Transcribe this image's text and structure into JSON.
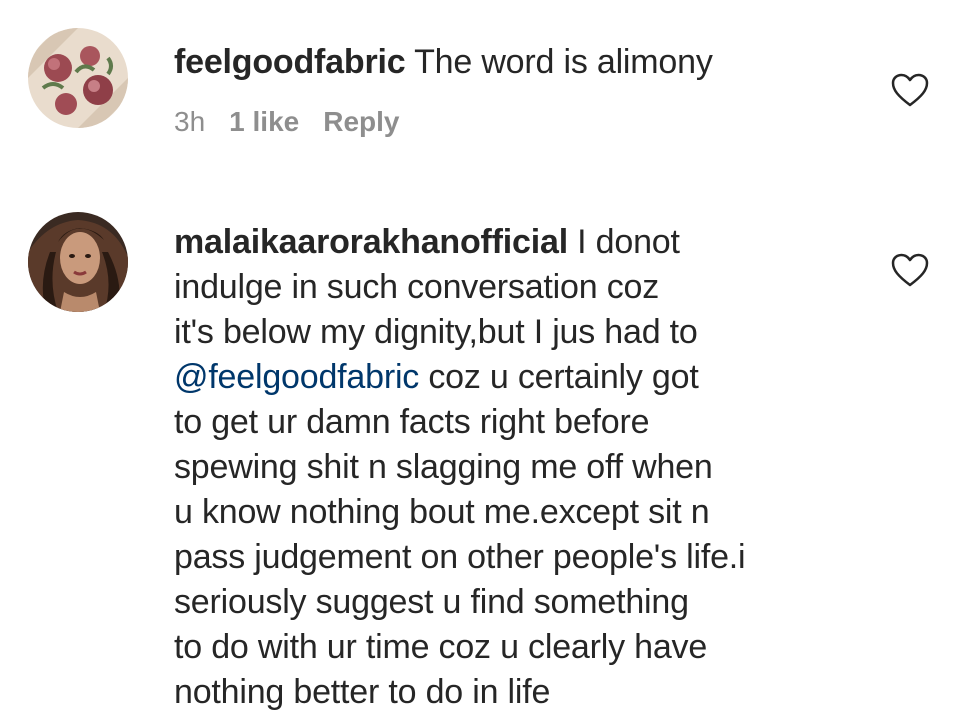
{
  "comments": [
    {
      "username": "feelgoodfabric",
      "text": " The word is alimony",
      "time": "3h",
      "likes": "1 like",
      "reply": "Reply",
      "avatar_icon": "floral-fabric-avatar",
      "like_icon": "heart-outline-icon"
    },
    {
      "username": "malaikaarorakhanofficial",
      "lines": [
        " I donot",
        "indulge in such conversation coz",
        "it's below my dignity,but I jus had to",
        "",
        "to get ur damn facts right before",
        "spewing shit n slagging me off when",
        "u know nothing bout me.except sit n",
        "pass judgement on other people's life.i",
        "seriously suggest u find something",
        "to do with ur time coz u clearly have",
        "nothing better to do in life"
      ],
      "mention": "@feelgoodfabric",
      "mention_tail": " coz u certainly got",
      "avatar_icon": "profile-photo-avatar",
      "like_icon": "heart-outline-icon"
    }
  ],
  "colors": {
    "text": "#262626",
    "meta": "#8e8e8e",
    "mention": "#00376b"
  }
}
